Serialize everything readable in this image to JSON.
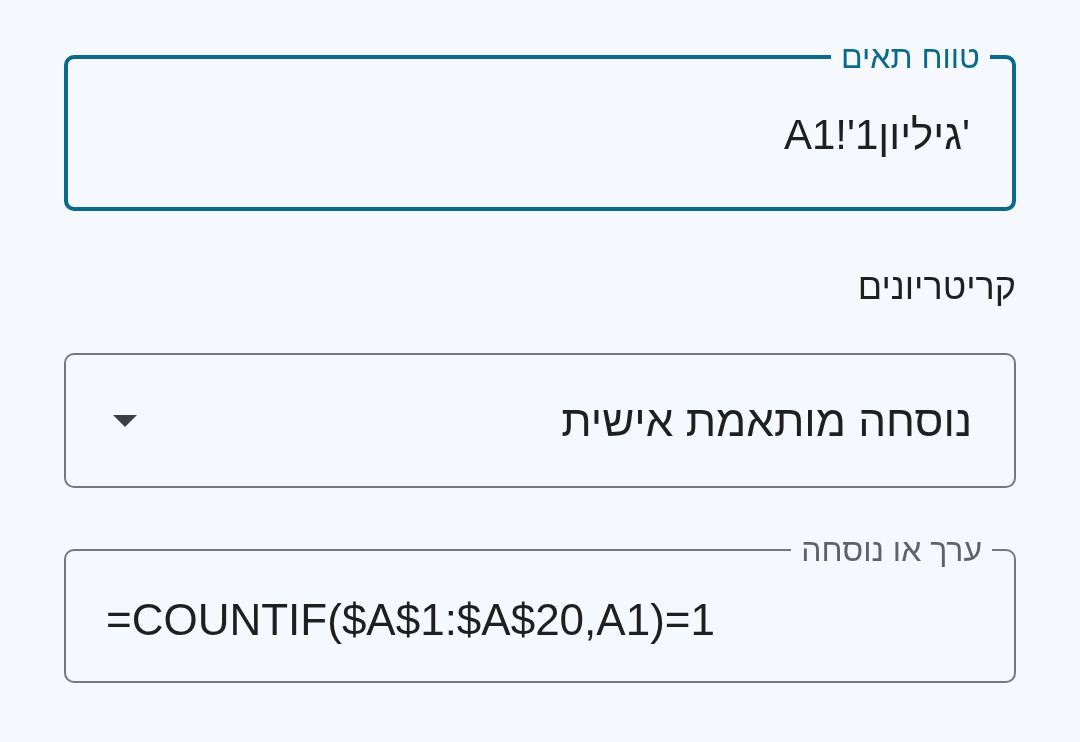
{
  "cell_range": {
    "label": "טווח תאים",
    "value": "'גיליון1'!A1",
    "focused": true
  },
  "criteria": {
    "label": "קריטריונים",
    "dropdown": {
      "value": "נוסחה מותאמת אישית"
    }
  },
  "value_or_formula": {
    "label": "ערך או נוסחה",
    "value": "=COUNTIF($A$1:$A$20,A1)=1",
    "focused": false
  }
}
